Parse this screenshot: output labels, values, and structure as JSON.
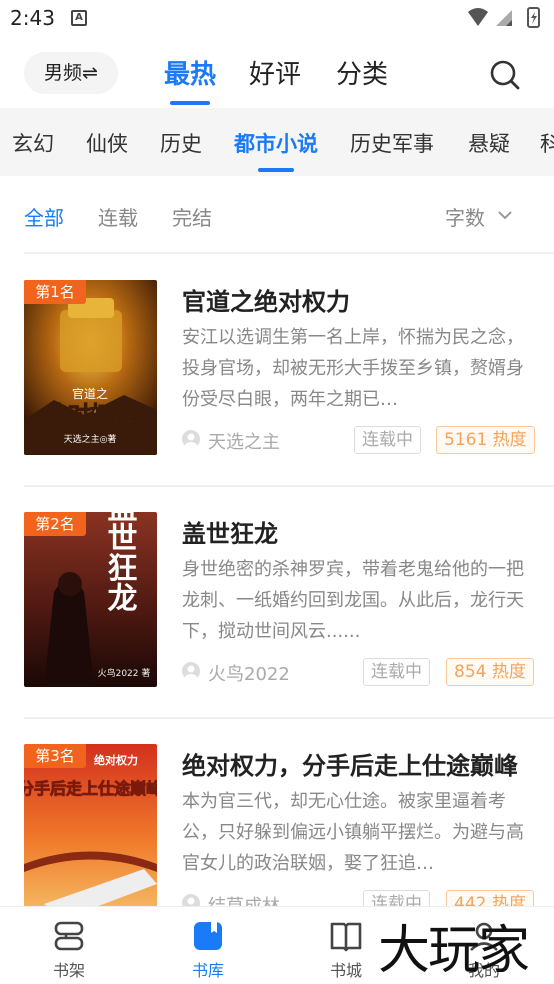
{
  "status_bar": {
    "time": "2:43"
  },
  "top_nav": {
    "gender_label": "男频⇌",
    "tabs": [
      "最热",
      "好评",
      "分类"
    ],
    "active_tab": "最热"
  },
  "categories": [
    "玄幻",
    "仙侠",
    "历史",
    "都市小说",
    "历史军事",
    "悬疑",
    "科"
  ],
  "active_category": "都市小说",
  "filters": [
    "全部",
    "连载",
    "完结"
  ],
  "sort_label": "字数",
  "books": [
    {
      "rank": "第1名",
      "title": "官道之绝对权力",
      "desc": "安江以选调生第一名上岸，怀揣为民之念，投身官场，却被无形大手拨至乡镇，赘婿身份受尽白眼，两年之期已…",
      "author": "天选之主",
      "status": "连载中",
      "heat": "5161 热度",
      "cover_title": "绝对权力",
      "cover_sub": "官道之",
      "cover_author": "天选之主◎著"
    },
    {
      "rank": "第2名",
      "title": "盖世狂龙",
      "desc": "身世绝密的杀神罗宾，带着老鬼给他的一把龙刺、一纸婚约回到龙国。从此后，龙行天下，搅动世间风云......",
      "author": "火鸟2022",
      "status": "连载中",
      "heat": "854 热度",
      "cover_title": "盖世狂龙",
      "cover_author": "火鸟2022 著"
    },
    {
      "rank": "第3名",
      "title": "绝对权力，分手后走上仕途巅峰",
      "desc": "本为官三代，却无心仕途。被家里逼着考公，只好躲到偏远小镇躺平摆烂。为避与高官女儿的政治联姻，娶了狂追…",
      "author": "结草成林",
      "status": "连载中",
      "heat": "442 热度",
      "cover_title": "分手后走上仕途巅峰",
      "cover_sub": "绝对权力"
    }
  ],
  "bottom_nav": [
    {
      "label": "书架",
      "icon": "bookshelf-icon"
    },
    {
      "label": "书库",
      "icon": "library-icon"
    },
    {
      "label": "书城",
      "icon": "open-book-icon"
    },
    {
      "label": "我的",
      "icon": "profile-icon"
    }
  ],
  "active_bottom": "书库",
  "watermark": "大玩家",
  "colors": {
    "accent": "#1a7af8",
    "rank_badge": "#f2641c",
    "heat": "#f4a35c"
  }
}
